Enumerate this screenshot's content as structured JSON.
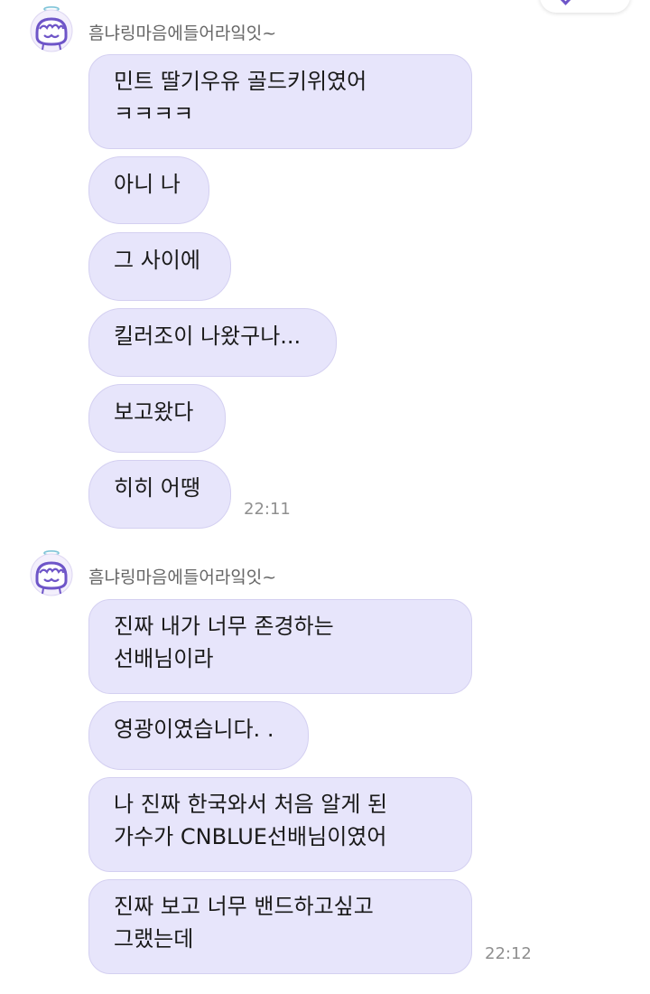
{
  "chat": {
    "groups": [
      {
        "sender": "흠냐링마음에들어라잌잇~",
        "messages": [
          {
            "text": "민트 딸기우유 골드키위였어\nㅋㅋㅋㅋ"
          },
          {
            "text": "아니 나"
          },
          {
            "text": "그 사이에"
          },
          {
            "text": "킬러조이 나왔구나..."
          },
          {
            "text": "보고왔다"
          },
          {
            "text": "히히 어땡",
            "time": "22:11"
          }
        ]
      },
      {
        "sender": "흠냐링마음에들어라잌잇~",
        "messages": [
          {
            "text": "진짜 내가 너무 존경하는\n선배님이라"
          },
          {
            "text": "영광이였습니다. ."
          },
          {
            "text": "나 진짜 한국와서 처음 알게 된\n가수가 CNBLUE선배님이였어"
          },
          {
            "text": "진짜 보고 너무 밴드하고싶고\n그랬는데",
            "time": "22:12"
          }
        ]
      }
    ]
  },
  "colors": {
    "bubble_bg": "#e7e5fb",
    "bubble_border": "#d4d0f1",
    "accent": "#6e55c8",
    "avatar_ring": "#9b83d9"
  },
  "icons": {
    "avatar": "pudding-character-avatar-icon",
    "top_right": "chevron-icon"
  }
}
